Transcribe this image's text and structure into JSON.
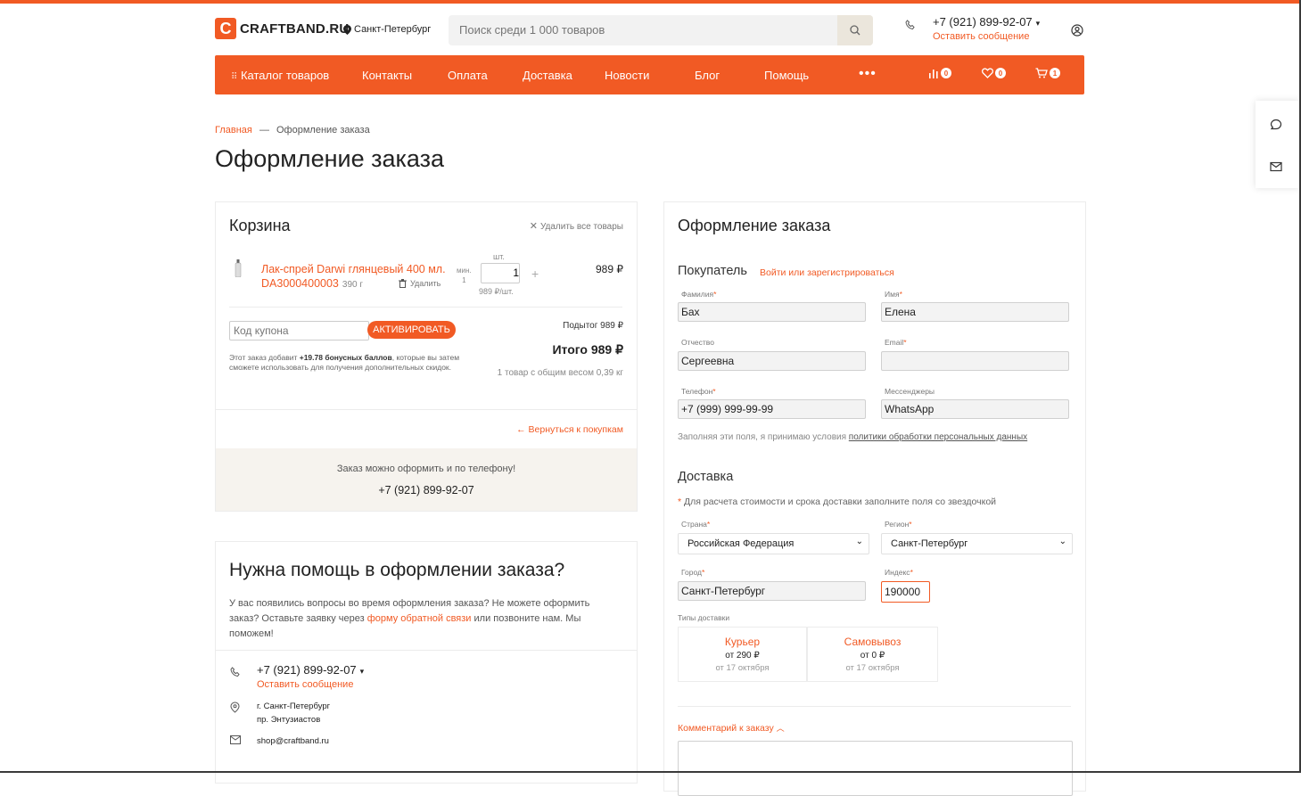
{
  "header": {
    "logo_letter": "C",
    "logo_text": "CRAFTBAND.RU",
    "city": "Санкт-Петербург",
    "search_placeholder": "Поиск среди 1 000 товаров",
    "phone": "+7 (921) 899-92-07",
    "message_link": "Оставить сообщение"
  },
  "nav": {
    "catalog": "Каталог товаров",
    "items": [
      "Контакты",
      "Оплата",
      "Доставка",
      "Новости",
      "Блог",
      "Помощь"
    ],
    "more": "•••",
    "compare_count": "0",
    "favorites_count": "0",
    "cart_count": "1"
  },
  "breadcrumb": {
    "home": "Главная",
    "separator": "—",
    "current": "Оформление заказа"
  },
  "page_title": "Оформление заказа",
  "cart": {
    "title": "Корзина",
    "clear_all": "Удалить все товары",
    "product": {
      "name": "Лак-спрей Darwi глянцевый 400 мл. DA3000400003",
      "weight": "390 г",
      "delete": "Удалить",
      "qty_unit_label": "шт.",
      "min_label": "мин.",
      "min_value": "1",
      "qty": "1",
      "plus": "+",
      "unit_price": "989 ₽/шт.",
      "price": "989 ₽"
    },
    "coupon_placeholder": "Код купона",
    "activate": "АКТИВИРОВАТЬ",
    "subtotal": "Подытог 989 ₽",
    "total": "Итого 989 ₽",
    "bonus_pre": "Этот заказ добавит ",
    "bonus_value": "+19.78 бонусных баллов",
    "bonus_post": ", которые вы затем сможете использовать для получения дополнительных скидок.",
    "weight_info": "1 товар с общим весом 0,39 кг",
    "back": "← Вернуться к покупкам",
    "phone_hint": "Заказ можно оформить и по телефону!",
    "phone": "+7 (921) 899-92-07"
  },
  "help": {
    "title": "Нужна помощь в оформлении заказа?",
    "text_pre": "У вас появились вопросы во время оформления заказа? Не можете оформить заказ? Оставьте заявку через ",
    "text_link": "форму обратной связи",
    "text_post": " или позвоните нам. Мы поможем!",
    "phone": "+7 (921) 899-92-07",
    "message_link": "Оставить сообщение",
    "address_line1": "г. Санкт-Петербург",
    "address_line2": "пр. Энтузиастов",
    "email": "shop@craftband.ru"
  },
  "order": {
    "title": "Оформление заказа",
    "buyer_heading": "Покупатель",
    "login_link": "Войти или зарегистрироваться",
    "fields": {
      "last_name_label": "Фамилия",
      "last_name": "Бах",
      "first_name_label": "Имя",
      "first_name": "Елена",
      "patronymic_label": "Отчество",
      "patronymic": "Сергеевна",
      "email_label": "Email",
      "email": "",
      "phone_label": "Телефон",
      "phone": "+7 (999) 999-99-99",
      "messengers_label": "Мессенджеры",
      "messengers": "WhatsApp"
    },
    "consent_pre": "Заполняя эти поля, я принимаю условия ",
    "consent_link": "политики обработки персональных данных",
    "delivery_heading": "Доставка",
    "delivery_hint": "Для расчета стоимости и срока доставки заполните поля со звездочкой",
    "country_label": "Страна",
    "country": "Российская Федерация",
    "region_label": "Регион",
    "region": "Санкт-Петербург",
    "city_label": "Город",
    "city": "Санкт-Петербург",
    "index_label": "Индекс",
    "index": "190000",
    "delivery_types_label": "Типы доставки",
    "delivery_types": [
      {
        "name": "Курьер",
        "price": "от 290 ₽",
        "date": "от 17 октября"
      },
      {
        "name": "Самовывоз",
        "price": "от 0 ₽",
        "date": "от 17 октября"
      }
    ],
    "comment_toggle": "Комментарий к заказу",
    "required_mark": "*"
  },
  "colors": {
    "accent": "#f15a24",
    "panel_beige": "#f6f3ee"
  }
}
